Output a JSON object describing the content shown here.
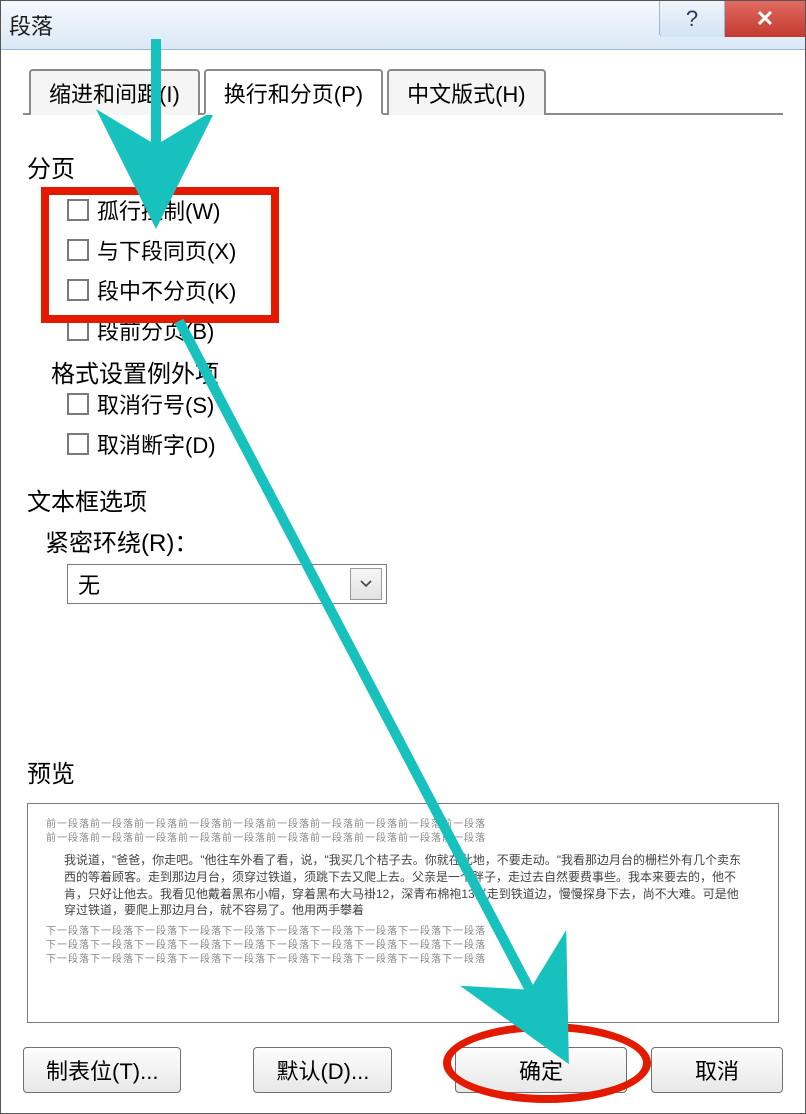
{
  "window": {
    "title": "段落",
    "help_glyph": "?",
    "close_glyph": "✕"
  },
  "tabs": [
    {
      "label": "缩进和间距(I)"
    },
    {
      "label": "换行和分页(P)"
    },
    {
      "label": "中文版式(H)"
    }
  ],
  "active_tab_index": 1,
  "pagination": {
    "title": "分页",
    "options": [
      {
        "label": "孤行控制(W)"
      },
      {
        "label": "与下段同页(X)"
      },
      {
        "label": "段中不分页(K)"
      },
      {
        "label": "段前分页(B)"
      }
    ]
  },
  "exceptions": {
    "title": "格式设置例外项",
    "options": [
      {
        "label": "取消行号(S)"
      },
      {
        "label": "取消断字(D)"
      }
    ]
  },
  "textbox": {
    "title": "文本框选项",
    "wrap_label": "紧密环绕(R)：",
    "wrap_value": "无"
  },
  "preview": {
    "title": "预览",
    "faint_repeat": "前一段落前一段落前一段落前一段落前一段落前一段落前一段落前一段落前一段落前一段落",
    "faint_repeat2": "下一段落下一段落下一段落下一段落下一段落下一段落下一段落下一段落下一段落下一段落",
    "body": "我说道，\"爸爸，你走吧。\"他往车外看了看，说，\"我买几个桔子去。你就在此地，不要走动。\"我看那边月台的栅栏外有几个卖东西的等着顾客。走到那边月台，须穿过铁道，须跳下去又爬上去。父亲是一个胖子，走过去自然要费事些。我本来要去的，他不肯，只好让他去。我看见他戴着黑布小帽，穿着黑布大马褂12，深青布棉袍13岁走到铁道边，慢慢探身下去，尚不大难。可是他穿过铁道，要爬上那边月台，就不容易了。他用两手攀着"
  },
  "footer": {
    "tabstops": "制表位(T)...",
    "default": "默认(D)...",
    "ok": "确定",
    "cancel": "取消"
  }
}
